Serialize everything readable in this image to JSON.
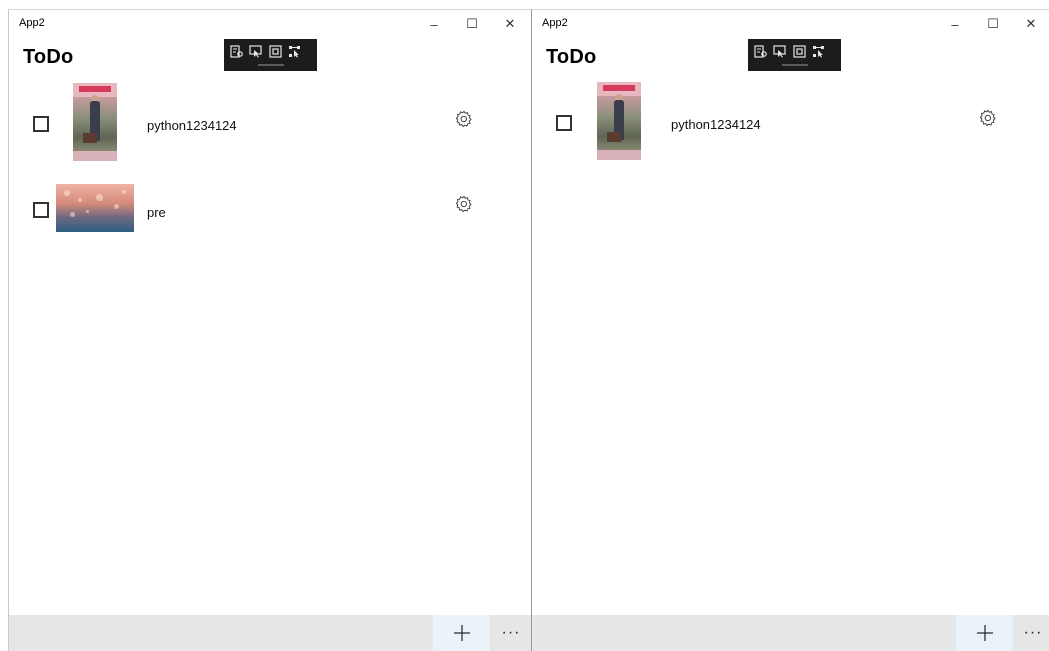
{
  "windows": [
    {
      "id": "left",
      "app_title": "App2",
      "page_title": "ToDo",
      "caption_buttons": {
        "minimize": "–",
        "maximize": "☐",
        "close": "✕"
      },
      "items": [
        {
          "text": "python1234124",
          "checked": false,
          "thumbnail": "poster-photo"
        },
        {
          "text": "pre",
          "checked": false,
          "thumbnail": "bokeh-photo"
        }
      ],
      "command_bar": {
        "add": "+",
        "more": "···"
      }
    },
    {
      "id": "right",
      "app_title": "App2",
      "page_title": "ToDo",
      "caption_buttons": {
        "minimize": "–",
        "maximize": "☐",
        "close": "✕"
      },
      "items": [
        {
          "text": "python1234124",
          "checked": false,
          "thumbnail": "poster-photo"
        }
      ],
      "command_bar": {
        "add": "+",
        "more": "···"
      }
    }
  ],
  "colors": {
    "dev_toolbar_bg": "#1c1c1c",
    "command_bar_bg": "#e6e6e6",
    "add_button_bg": "#ebf3fa"
  },
  "icons": [
    "live-visual-tree-icon",
    "select-element-icon",
    "display-layout-adorners-icon",
    "track-focus-icon",
    "settings-gear-icon",
    "add-icon",
    "more-icon"
  ]
}
